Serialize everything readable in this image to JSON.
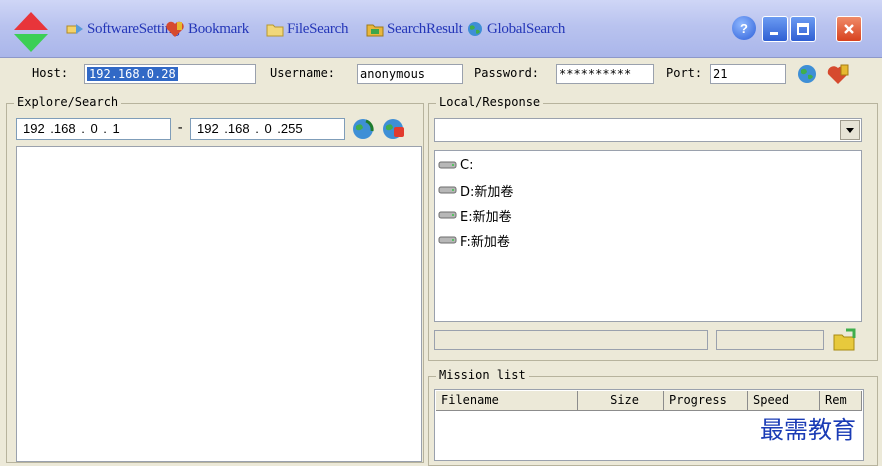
{
  "toolbar": {
    "items": [
      {
        "label": "SoftwareSetting",
        "icon": "settings-icon"
      },
      {
        "label": "Bookmark",
        "icon": "heart-bookmark-icon"
      },
      {
        "label": "FileSearch",
        "icon": "file-search-icon"
      },
      {
        "label": "SearchResult",
        "icon": "folder-result-icon"
      },
      {
        "label": "GlobalSearch",
        "icon": "globe-search-icon"
      }
    ]
  },
  "connection": {
    "host_label": "Host:",
    "host_value": "192.168.0.28",
    "username_label": "Username:",
    "username_value": "anonymous",
    "password_label": "Password:",
    "password_value": "**********",
    "port_label": "Port:",
    "port_value": "21"
  },
  "explore": {
    "title": "Explore/Search",
    "ip_start": "192 .168 . 0  . 1",
    "range_sep": "-",
    "ip_end": "192 .168 . 0  .255"
  },
  "local": {
    "title": "Local/Response",
    "drives": [
      "C:",
      "D:新加卷",
      "E:新加卷",
      "F:新加卷"
    ]
  },
  "mission": {
    "title": "Mission list",
    "columns": [
      "Filename",
      "Size",
      "Progress",
      "Speed",
      "Rem"
    ]
  },
  "watermark": "最需教育",
  "colors": {
    "link_blue": "#2436b8",
    "close_red": "#e4502f",
    "selection": "#3169c6"
  }
}
